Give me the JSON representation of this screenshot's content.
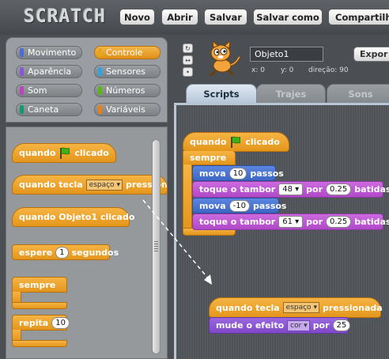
{
  "app": {
    "logo": "SCRATCH",
    "menu": {
      "new": "Novo",
      "open": "Abrir",
      "save": "Salvar",
      "save_as": "Salvar como",
      "share": "Compartilh"
    }
  },
  "categories": [
    {
      "label": "Movimento",
      "color": "#4a6cd4"
    },
    {
      "label": "Controle",
      "color": "#e1a91a",
      "selected": true
    },
    {
      "label": "Aparência",
      "color": "#8a55d7"
    },
    {
      "label": "Sensores",
      "color": "#2ca5e2"
    },
    {
      "label": "Som",
      "color": "#bb42c3"
    },
    {
      "label": "Números",
      "color": "#5cb712"
    },
    {
      "label": "Caneta",
      "color": "#0e9a6c"
    },
    {
      "label": "Variáveis",
      "color": "#ee7d16"
    }
  ],
  "palette": {
    "flag_hat": {
      "pre": "quando",
      "post": "clicado"
    },
    "key_hat": {
      "pre": "quando tecla",
      "key": "espaço",
      "post": "pressionada"
    },
    "click_hat": {
      "text": "quando Objeto1 clicado"
    },
    "wait": {
      "pre": "espere",
      "value": "1",
      "post": "segundos"
    },
    "forever": {
      "label": "sempre"
    },
    "repeat": {
      "label": "repita",
      "value": "10"
    }
  },
  "sprite": {
    "name": "Objeto1",
    "export_label": "Expor",
    "x_label": "x: 0",
    "y_label": "y: 0",
    "direction_label": "direção: 90"
  },
  "tabs": [
    {
      "label": "Scripts",
      "active": true
    },
    {
      "label": "Trajes",
      "active": false
    },
    {
      "label": "Sons",
      "active": false
    }
  ],
  "script1": {
    "hat": {
      "pre": "quando",
      "post": "clicado"
    },
    "forever": "sempre",
    "move1": {
      "label": "mova",
      "value": "10",
      "post": "passos"
    },
    "drum1": {
      "label": "toque o tambor",
      "drum": "48",
      "mid": "por",
      "beats": "0.25",
      "post": "batidas"
    },
    "move2": {
      "label": "mova",
      "value": "-10",
      "post": "passos"
    },
    "drum2": {
      "label": "toque o tambor",
      "drum": "61",
      "mid": "por",
      "beats": "0.25",
      "post": "batidas"
    }
  },
  "script2": {
    "hat": {
      "pre": "quando tecla",
      "key": "espaço",
      "post": "pressionada"
    },
    "effect": {
      "label": "mude o efeito",
      "effect": "cor",
      "mid": "por",
      "value": "25"
    }
  }
}
